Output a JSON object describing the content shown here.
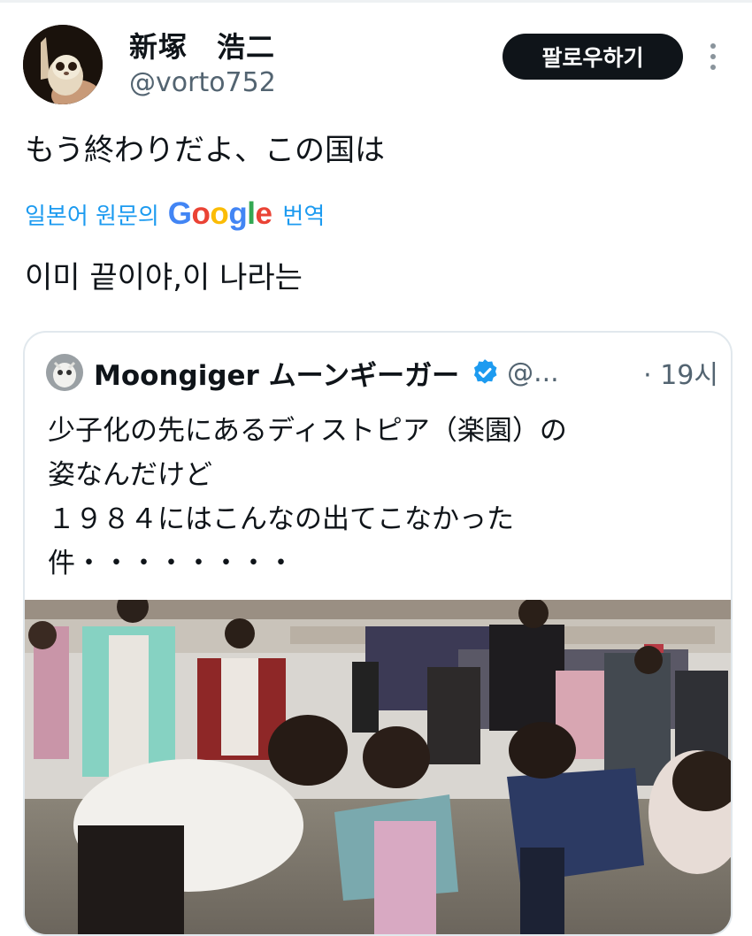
{
  "tweet": {
    "display_name": "新塚　浩二",
    "handle": "@vorto752",
    "follow_label": "팔로우하기",
    "text": "もう終わりだよ、この国は",
    "translate_prefix": "일본어 원문의",
    "translate_brand": "Google",
    "translate_suffix": "번역",
    "translated_text": "이미 끝이야,이 나라는"
  },
  "quote": {
    "name": "Moongiger ムーンギーガー",
    "handle": "@...",
    "time": "· 19시",
    "text": "少子化の先にあるディストピア（楽園）の\n姿なんだけど\n１９８４にはこんなの出てこなかった\n件・・・・・・・・"
  },
  "colors": {
    "link": "#1d9bf0",
    "follow_bg": "#0f1419",
    "secondary_text": "#536471",
    "verified": "#1d9bf0",
    "google": [
      "#4285F4",
      "#EA4335",
      "#FBBC05",
      "#34A853"
    ]
  },
  "icons": {
    "more": "more-vertical-icon",
    "verified": "verified-badge-icon"
  }
}
